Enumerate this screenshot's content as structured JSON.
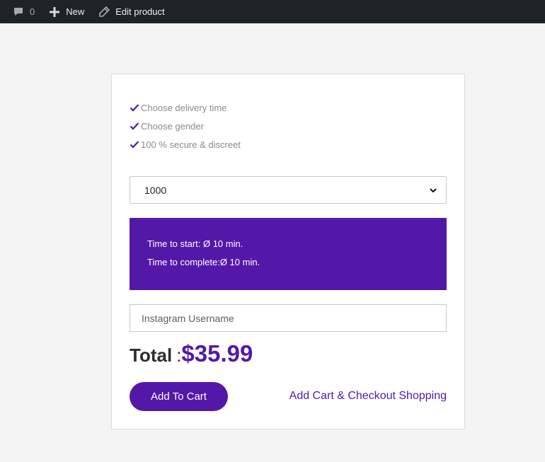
{
  "admin_bar": {
    "comments_count": "0",
    "new_label": "New",
    "edit_label": "Edit product"
  },
  "product": {
    "features": [
      "Choose delivery time",
      "Choose gender",
      "100 % secure & discreet"
    ],
    "quantity": {
      "selected": "1000"
    },
    "time": {
      "start": "Time to start: Ø 10 min.",
      "complete": "Time to complete:Ø 10 min."
    },
    "username": {
      "placeholder": "Instagram Username",
      "value": ""
    },
    "total": {
      "label": "Total",
      "separator": ":",
      "price": "$35.99"
    },
    "add_to_cart_label": "Add To Cart",
    "checkout_label": "Add Cart & Checkout Shopping"
  },
  "colors": {
    "accent": "#5418a8",
    "admin_bar": "#1d2327",
    "page_bg": "#f4f4f4"
  },
  "icons": {
    "comments": "comment-bubble-icon",
    "new": "plus-icon",
    "edit": "pencil-icon",
    "feature": "checkmark-icon",
    "select": "chevron-down-icon"
  }
}
